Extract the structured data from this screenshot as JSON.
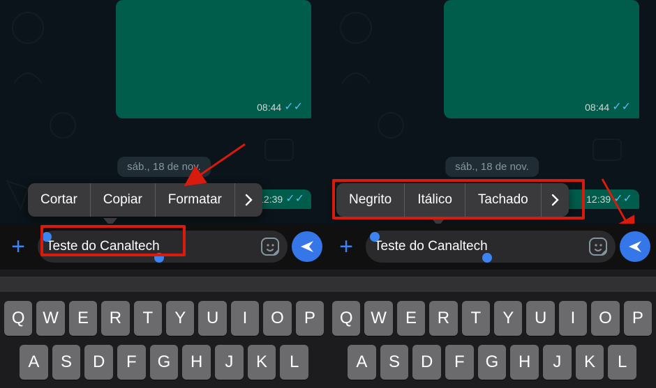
{
  "common": {
    "msg_time": "08:44",
    "prev_msg_time": "12:39",
    "date_label": "sáb., 18 de nov.",
    "input_text": "Teste do Canaltech",
    "colors": {
      "accent_blue": "#3b84f2",
      "bubble_green": "#005c4b",
      "menu_bg": "#3a3a3c",
      "red_highlight": "#d81b0d"
    },
    "keyboard": {
      "row1": [
        "Q",
        "W",
        "E",
        "R",
        "T",
        "Y",
        "U",
        "I",
        "O",
        "P"
      ],
      "row2": [
        "A",
        "S",
        "D",
        "F",
        "G",
        "H",
        "J",
        "K",
        "L"
      ]
    }
  },
  "left": {
    "menu": {
      "items": [
        {
          "label": "Cortar"
        },
        {
          "label": "Copiar"
        },
        {
          "label": "Formatar"
        }
      ]
    }
  },
  "right": {
    "menu": {
      "items": [
        {
          "label": "Negrito"
        },
        {
          "label": "Itálico"
        },
        {
          "label": "Tachado"
        }
      ]
    }
  }
}
